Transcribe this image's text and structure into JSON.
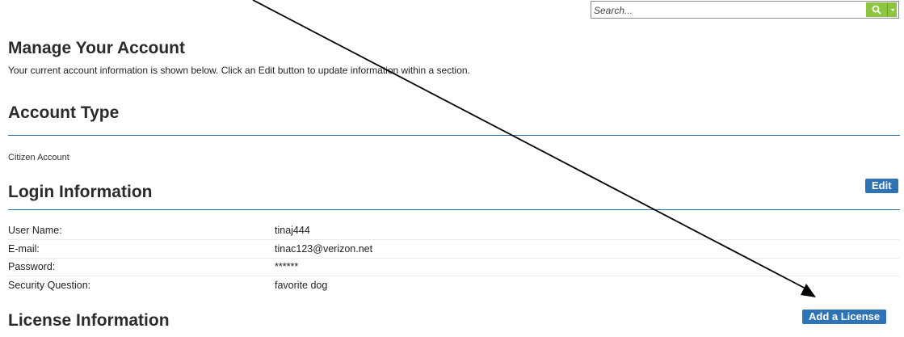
{
  "search": {
    "placeholder": "Search..."
  },
  "page": {
    "title": "Manage Your Account",
    "intro": "Your current account information is shown below. Click an Edit button to update information within a section."
  },
  "account_type": {
    "title": "Account Type",
    "value": "Citizen Account"
  },
  "login": {
    "title": "Login Information",
    "edit_label": "Edit",
    "rows": [
      {
        "label": "User Name:",
        "value": "tinaj444"
      },
      {
        "label": "E-mail:",
        "value": "tinac123@verizon.net"
      },
      {
        "label": "Password:",
        "value": "******"
      },
      {
        "label": "Security Question:",
        "value": "favorite dog"
      }
    ]
  },
  "license": {
    "title": "License Information",
    "add_label": "Add a License"
  },
  "colors": {
    "accent": "#2e74b5",
    "search_button": "#8cc63f"
  }
}
